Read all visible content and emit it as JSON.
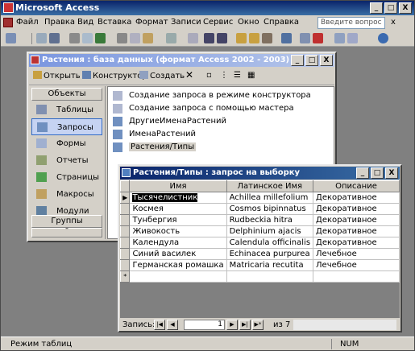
{
  "app": {
    "title": "Microsoft Access"
  },
  "window_buttons": {
    "minimize": "_",
    "maximize": "□",
    "close": "X"
  },
  "menu": {
    "items": [
      "Файл",
      "Правка",
      "Вид",
      "Вставка",
      "Формат",
      "Записи",
      "Сервис",
      "Окно",
      "Справка"
    ],
    "help_placeholder": "Введите вопрос",
    "close": "x"
  },
  "db_window": {
    "title": "Растения : база данных (формат Access 2002 - 2003)",
    "toolbar": {
      "open": "Открыть",
      "designer": "Конструктор",
      "create": "Создать"
    },
    "objects_header": "Объекты",
    "groups_header": "Группы",
    "objects": [
      "Таблицы",
      "Запросы",
      "Формы",
      "Отчеты",
      "Страницы",
      "Макросы",
      "Модули"
    ],
    "selected_object": "Запросы",
    "list": [
      "Создание запроса в режиме конструктора",
      "Создание запроса с помощью мастера",
      "ДругиеИменаРастений",
      "ИменаРастений",
      "Растения/Типы"
    ],
    "selected_item": "Растения/Типы"
  },
  "query_window": {
    "title": "Растения/Типы : запрос на выборку",
    "columns": [
      "Имя",
      "Латинское Имя",
      "Описание"
    ],
    "rows": [
      [
        "Тысячелистник",
        "Achillea millefolium",
        "Декоративное"
      ],
      [
        "Космея",
        "Cosmos bipinnatus",
        "Декоративное"
      ],
      [
        "Тунбергия",
        "Rudbeckia hitra",
        "Декоративное"
      ],
      [
        "Живокость",
        "Delphinium ajacis",
        "Декоративное"
      ],
      [
        "Календула",
        "Calendula officinalis",
        "Декоративное"
      ],
      [
        "Синий василек",
        "Echinacea purpurea",
        "Лечебное"
      ],
      [
        "Германская ромашка",
        "Matricaria recutita",
        "Лечебное"
      ]
    ],
    "new_row_marker": "*",
    "current_row_marker": "▶",
    "nav": {
      "label": "Запись:",
      "current": "1",
      "of_label": "из",
      "total": "7"
    }
  },
  "status": {
    "text": "Режим таблиц",
    "num": "NUM"
  }
}
